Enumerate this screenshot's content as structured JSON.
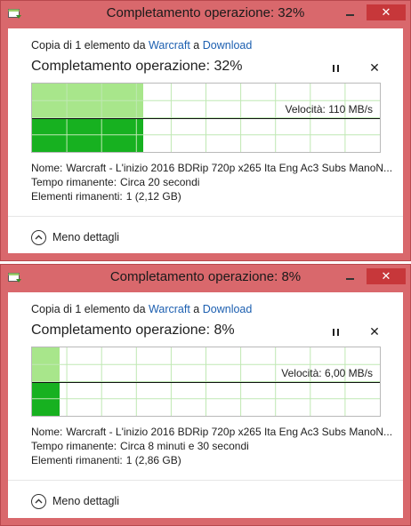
{
  "colors": {
    "frame": "#d9686c",
    "fill_light": "#a8e68b",
    "fill_dark": "#17b120",
    "link": "#1c5fb0"
  },
  "dialogs": [
    {
      "title": "Completamento operazione: 32%",
      "copy_prefix": "Copia di 1 elemento da",
      "source": "Warcraft",
      "connector": "a",
      "destination": "Download",
      "heading": "Completamento operazione: 32%",
      "progress_percent": 32,
      "speed_label": "Velocità: 110 MB/s",
      "name_label": "Nome:",
      "name_value": "Warcraft - L'inizio 2016 BDRip 720p x265 Ita Eng Ac3 Subs ManoN...",
      "time_label": "Tempo rimanente:",
      "time_value": "Circa 20 secondi",
      "items_label": "Elementi rimanenti:",
      "items_value": "1 (2,12 GB)",
      "less_details": "Meno dettagli"
    },
    {
      "title": "Completamento operazione: 8%",
      "copy_prefix": "Copia di 1 elemento da",
      "source": "Warcraft",
      "connector": "a",
      "destination": "Download",
      "heading": "Completamento operazione: 8%",
      "progress_percent": 8,
      "speed_label": "Velocità: 6,00 MB/s",
      "name_label": "Nome:",
      "name_value": "Warcraft - L'inizio 2016 BDRip 720p x265 Ita Eng Ac3 Subs ManoN...",
      "time_label": "Tempo rimanente:",
      "time_value": "Circa 8 minuti e 30 secondi",
      "items_label": "Elementi rimanenti:",
      "items_value": "1 (2,86 GB)",
      "less_details": "Meno dettagli"
    }
  ]
}
